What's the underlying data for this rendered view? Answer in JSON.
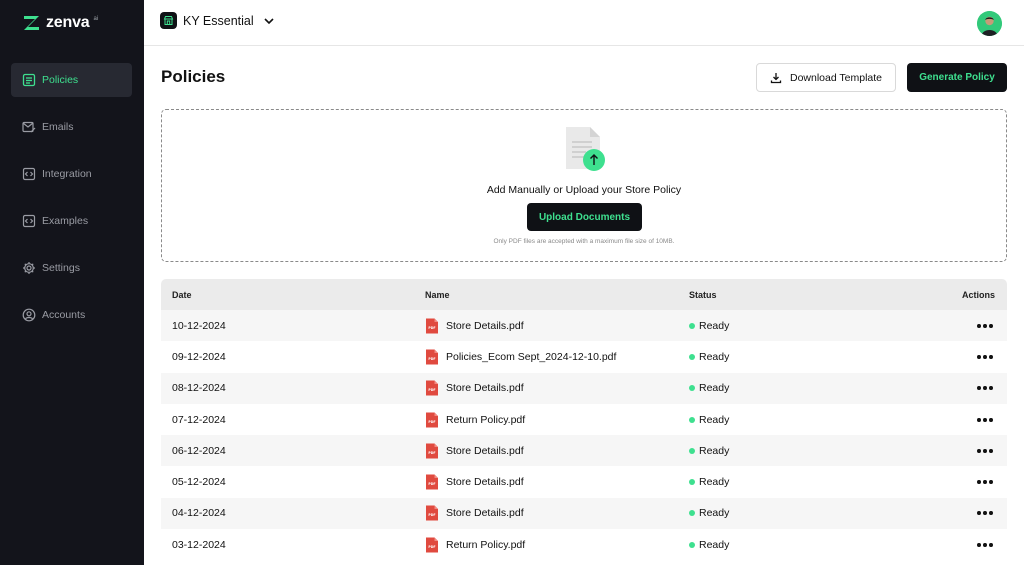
{
  "brand": {
    "name": "zenva",
    "sup": "ai"
  },
  "sidebar": {
    "items": [
      {
        "label": "Policies",
        "icon": "policy-icon",
        "active": true
      },
      {
        "label": "Emails",
        "icon": "email-icon",
        "active": false
      },
      {
        "label": "Integration",
        "icon": "integration-icon",
        "active": false
      },
      {
        "label": "Examples",
        "icon": "examples-icon",
        "active": false
      },
      {
        "label": "Settings",
        "icon": "settings-icon",
        "active": false
      },
      {
        "label": "Accounts",
        "icon": "account-icon",
        "active": false
      }
    ]
  },
  "topbar": {
    "workspace": "KY Essential"
  },
  "page": {
    "title": "Policies",
    "download_label": "Download Template",
    "generate_label": "Generate Policy"
  },
  "upload": {
    "heading": "Add Manually or Upload your Store Policy",
    "button": "Upload Documents",
    "note": "Only PDF files are accepted with a maximum file size of 10MB."
  },
  "table": {
    "headers": {
      "date": "Date",
      "name": "Name",
      "status": "Status",
      "actions": "Actions"
    },
    "rows": [
      {
        "date": "10-12-2024",
        "name": "Store Details.pdf",
        "status": "Ready"
      },
      {
        "date": "09-12-2024",
        "name": "Policies_Ecom Sept_2024-12-10.pdf",
        "status": "Ready"
      },
      {
        "date": "08-12-2024",
        "name": "Store Details.pdf",
        "status": "Ready"
      },
      {
        "date": "07-12-2024",
        "name": "Return Policy.pdf",
        "status": "Ready"
      },
      {
        "date": "06-12-2024",
        "name": "Store Details.pdf",
        "status": "Ready"
      },
      {
        "date": "05-12-2024",
        "name": "Store Details.pdf",
        "status": "Ready"
      },
      {
        "date": "04-12-2024",
        "name": "Store Details.pdf",
        "status": "Ready"
      },
      {
        "date": "03-12-2024",
        "name": "Return Policy.pdf",
        "status": "Ready"
      }
    ]
  },
  "colors": {
    "sidebar_bg": "#13141b",
    "accent": "#3ee08f",
    "dark_button": "#0f1115",
    "pdf_red": "#e04a3f"
  }
}
